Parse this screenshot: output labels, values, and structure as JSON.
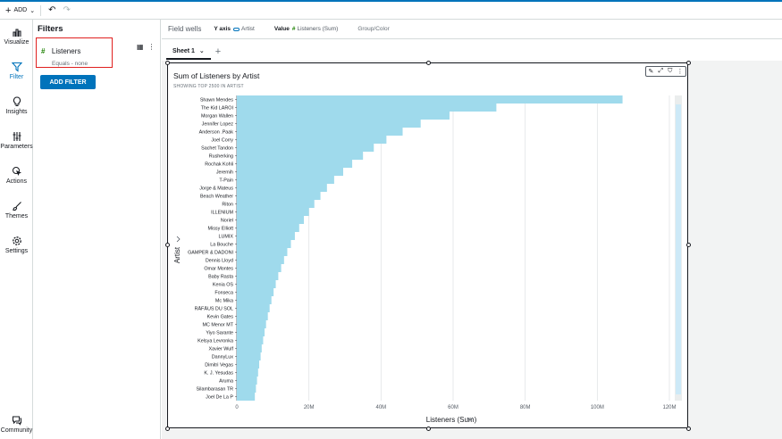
{
  "topbar": {
    "add_label": "ADD"
  },
  "nav": [
    {
      "label": "Visualize",
      "icon": "bar-chart-icon"
    },
    {
      "label": "Filter",
      "icon": "funnel-icon"
    },
    {
      "label": "Insights",
      "icon": "lightbulb-icon"
    },
    {
      "label": "Parameters",
      "icon": "sliders-icon"
    },
    {
      "label": "Actions",
      "icon": "pointer-icon"
    },
    {
      "label": "Themes",
      "icon": "brush-icon"
    },
    {
      "label": "Settings",
      "icon": "gear-icon"
    },
    {
      "label": "Community",
      "icon": "chat-icon"
    }
  ],
  "filters": {
    "title": "Filters",
    "card": {
      "field": "Listeners",
      "condition": "Equals - none"
    },
    "add_button": "ADD FILTER"
  },
  "fieldwells": {
    "title": "Field wells",
    "y_axis_label": "Y axis",
    "y_axis_value": "Artist",
    "value_label": "Value",
    "value_value": "Listeners (Sum)",
    "group_label": "Group/Color"
  },
  "sheet": {
    "tab": "Sheet 1"
  },
  "colors": {
    "accent": "#0073bb",
    "bar": "#9fdaec",
    "highlight": "#e0201f"
  },
  "chart_data": {
    "type": "bar",
    "orientation": "horizontal",
    "title": "Sum of Listeners by Artist",
    "subtitle": "SHOWING TOP 2500 IN ARTIST",
    "xlabel": "Listeners (Sum)",
    "ylabel": "Artist",
    "xlim": [
      0,
      120000000
    ],
    "x_ticks": [
      "0",
      "20M",
      "40M",
      "60M",
      "80M",
      "100M",
      "120M"
    ],
    "categories": [
      "Shawn Mendes",
      "The Kid LAROI",
      "Morgan Wallen",
      "Jennifer Lopez",
      "Anderson .Paak",
      "Joel Corry",
      "Sachet Tandon",
      "Rusherking",
      "Rochak Kohli",
      "Jeremih",
      "T-Pain",
      "Jorge & Mateus",
      "Beach Weather",
      "Riton",
      "ILLENIUM",
      "Noriel",
      "Missy Elliott",
      "LUMIX",
      "La Bouche",
      "GAMPER & DADONI",
      "Dennis Lloyd",
      "Omar Montes",
      "Baby Rasta",
      "Kenia OS",
      "Fonseca",
      "Mc Mika",
      "RÄFÄUS DU SOL",
      "Kevin Gates",
      "MC Menor MT",
      "Yiyo Sarante",
      "Kelsya Levronka",
      "Xavier Wulf",
      "DannyLux",
      "Dimitri Vegas",
      "K. J. Yesudas",
      "Aruma",
      "Silambarasan TR",
      "Joel De La P"
    ],
    "values": [
      107000000,
      72000000,
      59000000,
      51000000,
      46000000,
      41500000,
      38000000,
      35000000,
      32000000,
      29500000,
      27000000,
      25000000,
      23200000,
      21500000,
      20000000,
      18600000,
      17300000,
      16100000,
      15000000,
      14000000,
      13100000,
      12300000,
      11500000,
      10800000,
      10200000,
      9600000,
      9100000,
      8600000,
      8100000,
      7700000,
      7300000,
      6900000,
      6600000,
      6200000,
      5900000,
      5600000,
      5300000,
      5000000
    ]
  }
}
